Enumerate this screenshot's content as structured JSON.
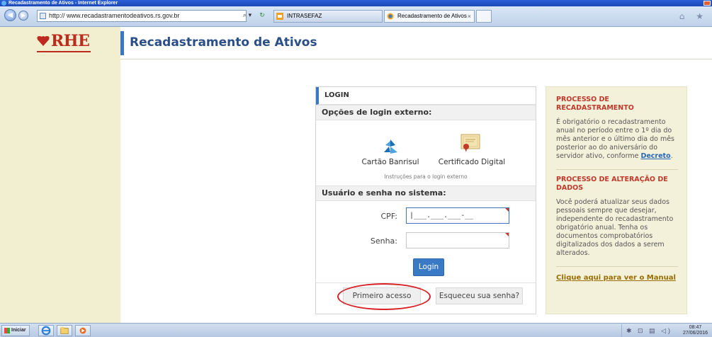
{
  "window": {
    "title": "Recadastramento de Ativos - Internet Explorer"
  },
  "browser": {
    "url": "http:// www.recadastramentodeativos.rs.gov.br",
    "search_glyph": "⌕ ▾",
    "refresh_glyph": "↻",
    "tabs": [
      {
        "label": "INTRASEFAZ",
        "active": false
      },
      {
        "label": "Recadastramento de Ativos",
        "active": true
      }
    ],
    "tab_close": "×",
    "right_icons": "⌂ ★"
  },
  "header": {
    "logo": "RHE",
    "title": "Recadastramento de Ativos"
  },
  "login": {
    "panel_title": "LOGIN",
    "external_heading": "Opções de login externo:",
    "banrisul_label": "Cartão Banrisul",
    "certificado_label": "Certificado Digital",
    "instructions": "Instruções para o login externo",
    "system_heading": "Usuário e senha no sistema:",
    "cpf_label": "CPF:",
    "cpf_value": "|___.___.___-__",
    "senha_label": "Senha:",
    "senha_value": "",
    "login_button": "Login",
    "first_access_button": "Primeiro acesso",
    "forgot_button": "Esqueceu sua senha?"
  },
  "info": {
    "process_title_1": "PROCESSO DE",
    "process_title_2": "RECADASTRAMENTO",
    "process_text": "É obrigatório o recadastramento anual no período entre o 1º dia do mês anterior e o último dia do mês posterior ao do aniversário do servidor ativo, conforme ",
    "decree_link": "Decreto",
    "process_text_end": ".",
    "alteration_title": "PROCESSO DE ALTERAÇÃO DE DADOS",
    "alteration_text": "Você poderá atualizar seus dados pessoais sempre que desejar, independente do recadastramento obrigatório anual. Tenha os documentos comprobatórios digitalizados dos dados a serem alterados.",
    "manual_link": "Clique aqui para ver o Manual"
  },
  "taskbar": {
    "start_label": "Iniciar",
    "tray_icons": "✱ ⊡ ▤ ◁)",
    "time": "08:47",
    "date": "27/06/2016"
  },
  "colors": {
    "accent_blue": "#3b78c4",
    "brand_red": "#bd2b1e",
    "sidebar_cream": "#f2efd0",
    "annotation_red": "#d71f25"
  }
}
